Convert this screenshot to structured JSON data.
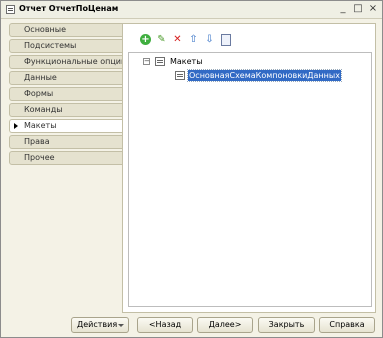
{
  "window": {
    "title": "Отчет ОтчетПоЦенам",
    "minimize": "_",
    "maximize": "□",
    "close": "×"
  },
  "tabs": [
    {
      "label": "Основные"
    },
    {
      "label": "Подсистемы"
    },
    {
      "label": "Функциональные опции"
    },
    {
      "label": "Данные"
    },
    {
      "label": "Формы"
    },
    {
      "label": "Команды"
    },
    {
      "label": "Макеты"
    },
    {
      "label": "Права"
    },
    {
      "label": "Прочее"
    }
  ],
  "active_tab": "Макеты",
  "toolbar": {
    "add_glyph": "+",
    "edit_glyph": "✎",
    "delete_glyph": "✕",
    "up_glyph": "⇧",
    "down_glyph": "⇩"
  },
  "tree": {
    "root": {
      "label": "Макеты",
      "expander": "−"
    },
    "child": {
      "label": "ОсновнаяСхемаКомпоновкиДанных",
      "selected": true
    }
  },
  "footer": {
    "actions": "Действия",
    "back": "<Назад",
    "next": "Далее>",
    "close": "Закрыть",
    "help": "Справка"
  },
  "colors": {
    "selection": "#316ac5",
    "window_bg": "#f4f2e6",
    "tab_bg": "#e5e2cf"
  }
}
